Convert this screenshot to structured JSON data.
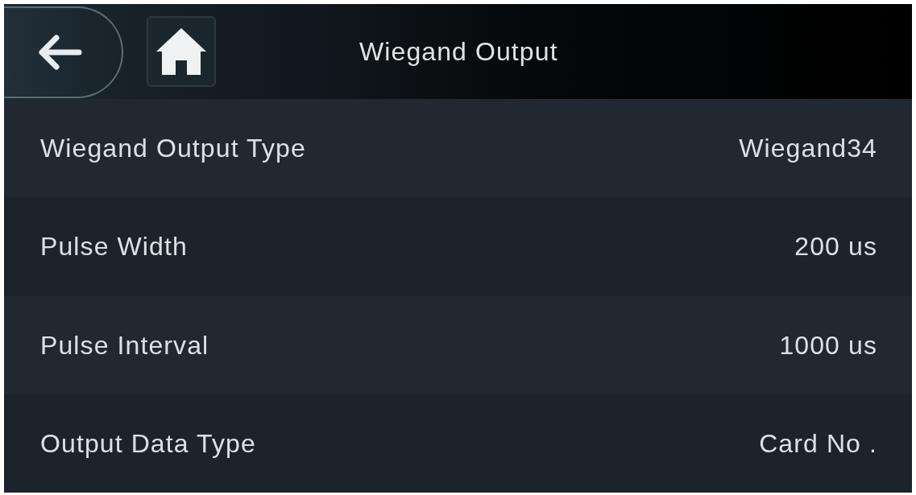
{
  "header": {
    "title": "Wiegand Output"
  },
  "settings": [
    {
      "label": "Wiegand Output Type",
      "value": "Wiegand34"
    },
    {
      "label": "Pulse Width",
      "value": "200 us"
    },
    {
      "label": "Pulse Interval",
      "value": "1000 us"
    },
    {
      "label": "Output Data Type",
      "value": "Card No ."
    }
  ]
}
